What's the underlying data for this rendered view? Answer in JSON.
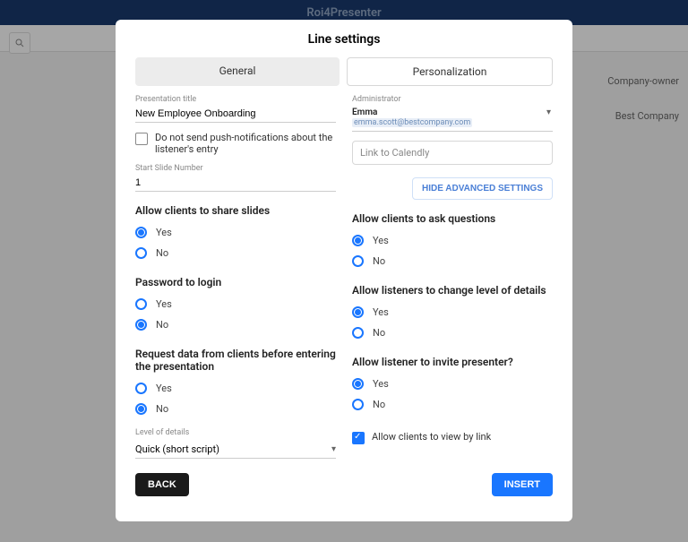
{
  "header": {
    "brand": "Roi4Presenter"
  },
  "bg": {
    "owner": "Company-owner",
    "company": "Best Company"
  },
  "modal": {
    "title": "Line settings",
    "tabs": {
      "general": "General",
      "personalization": "Personalization"
    },
    "left": {
      "pres_title_label": "Presentation title",
      "pres_title_value": "New Employee Onboarding",
      "no_push": "Do not send push-notifications about the listener's entry",
      "start_slide_label": "Start Slide Number",
      "start_slide_value": "1",
      "share": {
        "title": "Allow clients to share slides",
        "yes": "Yes",
        "no": "No"
      },
      "pwd": {
        "title": "Password to login",
        "yes": "Yes",
        "no": "No"
      },
      "req": {
        "title": "Request data from clients before entering the presentation",
        "yes": "Yes",
        "no": "No"
      },
      "lod_label": "Level of details",
      "lod_value": "Quick (short script)"
    },
    "right": {
      "admin_label": "Administrator",
      "admin_name": "Emma",
      "admin_email": "emma.scott@bestcompany.com",
      "calendly": "Link to Calendly",
      "hide_adv": "HIDE ADVANCED SETTINGS",
      "ask": {
        "title": "Allow clients to ask questions",
        "yes": "Yes",
        "no": "No"
      },
      "level": {
        "title": "Allow listeners to change level of details",
        "yes": "Yes",
        "no": "No"
      },
      "invite": {
        "title": "Allow listener to invite presenter?",
        "yes": "Yes",
        "no": "No"
      },
      "view_link": "Allow clients to view by link"
    },
    "footer": {
      "back": "BACK",
      "insert": "INSERT"
    }
  }
}
